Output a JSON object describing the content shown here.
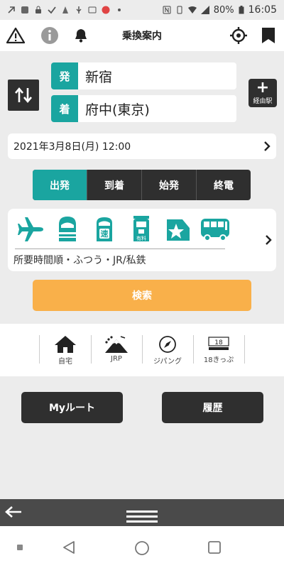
{
  "status_bar": {
    "battery": "80%",
    "time": "16:05",
    "icons": [
      "notification-icon",
      "app-icon",
      "lock-icon",
      "check-icon",
      "app-icon",
      "usb-icon",
      "message-icon",
      "app-icon",
      "dot-icon",
      "nfc-icon",
      "vibrate-icon",
      "wifi-icon",
      "signal-icon",
      "battery-icon"
    ]
  },
  "header": {
    "title": "乗換案内",
    "icons": {
      "warning": "warning-icon",
      "info": "info-icon",
      "bell": "bell-icon",
      "location": "crosshair-icon",
      "bookmark": "bookmark-icon"
    }
  },
  "route": {
    "from_tag": "発",
    "from_station": "新宿",
    "to_tag": "着",
    "to_station": "府中(東京)",
    "via_label": "経由駅",
    "via_plus": "+"
  },
  "datetime": {
    "value": "2021年3月8日(月) 12:00"
  },
  "time_type": {
    "options": [
      "出発",
      "到着",
      "始発",
      "終電"
    ],
    "selected": "出発"
  },
  "transport": {
    "modes": [
      "airplane-icon",
      "shinkansen-icon",
      "express-icon",
      "paid-express-icon",
      "limited-express-icon",
      "bus-icon"
    ],
    "express_char": "速",
    "paid_char": "有料",
    "summary": "所要時間順・ふつう・JR/私鉄"
  },
  "search": {
    "label": "検索"
  },
  "shortcuts": [
    {
      "label": "自宅",
      "icon": "home-icon"
    },
    {
      "label": "JRP",
      "icon": "mountain-icon"
    },
    {
      "label": "ジパング",
      "icon": "compass-icon"
    },
    {
      "label": "18きっぷ",
      "icon": "ticket-18-icon",
      "badge": "18"
    }
  ],
  "actions": {
    "my_route": "Myルート",
    "history": "履歴"
  },
  "colors": {
    "accent": "#1aa5a0",
    "search": "#f9b04a",
    "dark": "#2f2f2f"
  }
}
